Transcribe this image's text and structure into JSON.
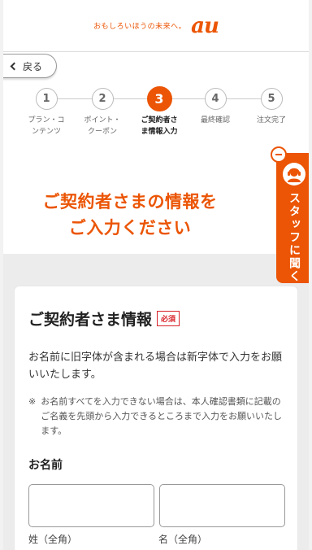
{
  "header": {
    "tagline": "おもしろいほうの未来へ。",
    "logo": "au"
  },
  "nav": {
    "back_label": "戻る"
  },
  "steps": [
    {
      "number": "1",
      "label_l1": "プラン・コ",
      "label_l2": "ンテンツ"
    },
    {
      "number": "2",
      "label_l1": "ポイント・",
      "label_l2": "クーポン"
    },
    {
      "number": "3",
      "label_l1": "ご契約者さ",
      "label_l2": "ま情報入力"
    },
    {
      "number": "4",
      "label_l1": "最終確認",
      "label_l2": ""
    },
    {
      "number": "5",
      "label_l1": "注文完了",
      "label_l2": ""
    }
  ],
  "current_step": 3,
  "heading": {
    "line1": "ご契約者さまの情報を",
    "line2": "ご入力ください"
  },
  "staff_button": {
    "label": "スタッフに聞く",
    "icon": "headset-person-icon"
  },
  "form": {
    "title": "ご契約者さま情報",
    "required_badge": "必須",
    "intro": "お名前に旧字体が含まれる場合は新字体で入力をお願いいたします。",
    "note_mark": "※",
    "note": "お名前すべてを入力できない場合は、本人確認書類に記載のご名義を先頭から入力できるところまで入力をお願いいたします。",
    "name_label": "お名前",
    "last_name": {
      "value": "",
      "placeholder": "",
      "sublabel": "姓（全角）"
    },
    "first_name": {
      "value": "",
      "placeholder": "",
      "sublabel": "名（全角）"
    }
  },
  "colors": {
    "brand": "#eb5505",
    "required": "#d8232a"
  }
}
